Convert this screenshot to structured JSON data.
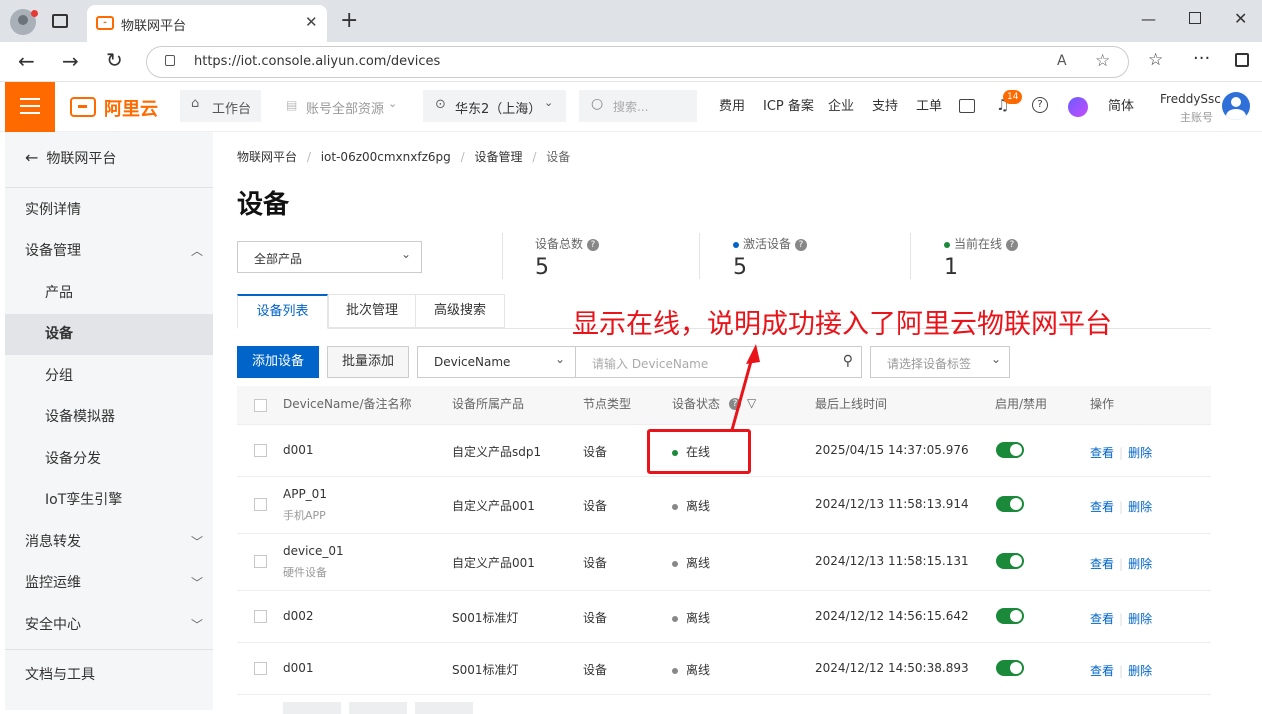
{
  "browser": {
    "tab_title": "物联网平台",
    "url": "https://iot.console.aliyun.com/devices",
    "new_tab": "+"
  },
  "topnav": {
    "logo_text": "阿里云",
    "workbench": "工作台",
    "account_resources": "账号全部资源",
    "region": "华东2（上海）",
    "search_placeholder": "搜索...",
    "links": [
      "费用",
      "ICP 备案",
      "企业",
      "支持",
      "工单"
    ],
    "notification_count": "14",
    "language": "简体",
    "user_name": "FreddySsc",
    "user_role": "主账号"
  },
  "sidebar": {
    "back_label": "物联网平台",
    "items": [
      {
        "label": "实例详情"
      },
      {
        "label": "设备管理"
      },
      {
        "label": "产品"
      },
      {
        "label": "设备"
      },
      {
        "label": "分组"
      },
      {
        "label": "设备模拟器"
      },
      {
        "label": "设备分发"
      },
      {
        "label": "IoT孪生引擎"
      },
      {
        "label": "消息转发"
      },
      {
        "label": "监控运维"
      },
      {
        "label": "安全中心"
      },
      {
        "label": "文档与工具"
      }
    ]
  },
  "breadcrumb": [
    "物联网平台",
    "iot-06z00cmxnxfz6pg",
    "设备管理",
    "设备"
  ],
  "page_title": "设备",
  "product_select": "全部产品",
  "stats": [
    {
      "label": "设备总数",
      "value": "5"
    },
    {
      "label": "激活设备",
      "value": "5"
    },
    {
      "label": "当前在线",
      "value": "1"
    }
  ],
  "tabs": [
    "设备列表",
    "批次管理",
    "高级搜索"
  ],
  "annotation": "显示在线，说明成功接入了阿里云物联网平台",
  "toolbar": {
    "add_device": "添加设备",
    "batch_add": "批量添加",
    "field_select": "DeviceName",
    "search_placeholder": "请输入 DeviceName",
    "tag_placeholder": "请选择设备标签"
  },
  "table": {
    "headers": [
      "DeviceName/备注名称",
      "设备所属产品",
      "节点类型",
      "设备状态",
      "最后上线时间",
      "启用/禁用",
      "操作"
    ],
    "rows": [
      {
        "name": "d001",
        "note": "",
        "product": "自定义产品sdp1",
        "node": "设备",
        "status": "在线",
        "last_online": "2025/04/15 14:37:05.976",
        "view": "查看",
        "delete": "删除"
      },
      {
        "name": "APP_01",
        "note": "手机APP",
        "product": "自定义产品001",
        "node": "设备",
        "status": "离线",
        "last_online": "2024/12/13 11:58:13.914",
        "view": "查看",
        "delete": "删除"
      },
      {
        "name": "device_01",
        "note": "硬件设备",
        "product": "自定义产品001",
        "node": "设备",
        "status": "离线",
        "last_online": "2024/12/13 11:58:15.131",
        "view": "查看",
        "delete": "删除"
      },
      {
        "name": "d002",
        "note": "",
        "product": "S001标准灯",
        "node": "设备",
        "status": "离线",
        "last_online": "2024/12/12 14:56:15.642",
        "view": "查看",
        "delete": "删除"
      },
      {
        "name": "d001",
        "note": "",
        "product": "S001标准灯",
        "node": "设备",
        "status": "离线",
        "last_online": "2024/12/12 14:50:38.893",
        "view": "查看",
        "delete": "删除"
      }
    ]
  },
  "colors": {
    "brand": "#ff6a00",
    "primary": "#0064c8",
    "online": "#1a8a3a",
    "offline": "#888888",
    "annotation": "#e8141a"
  }
}
